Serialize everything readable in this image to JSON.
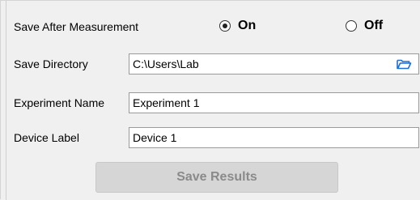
{
  "form": {
    "save_after_label": "Save After Measurement",
    "on_label": "On",
    "off_label": "Off",
    "selected": "On",
    "directory_label": "Save Directory",
    "directory_value": "C:\\Users\\Lab",
    "experiment_label": "Experiment Name",
    "experiment_value": "Experiment 1",
    "device_label": "Device Label",
    "device_value": "Device 1",
    "save_button": "Save Results",
    "save_button_enabled": false
  },
  "icons": {
    "folder": "folder-open-icon"
  },
  "colors": {
    "folder_icon": "#1d6fd1",
    "disabled_button_bg": "#d6d6d6",
    "disabled_button_text": "#8a8a8a"
  }
}
